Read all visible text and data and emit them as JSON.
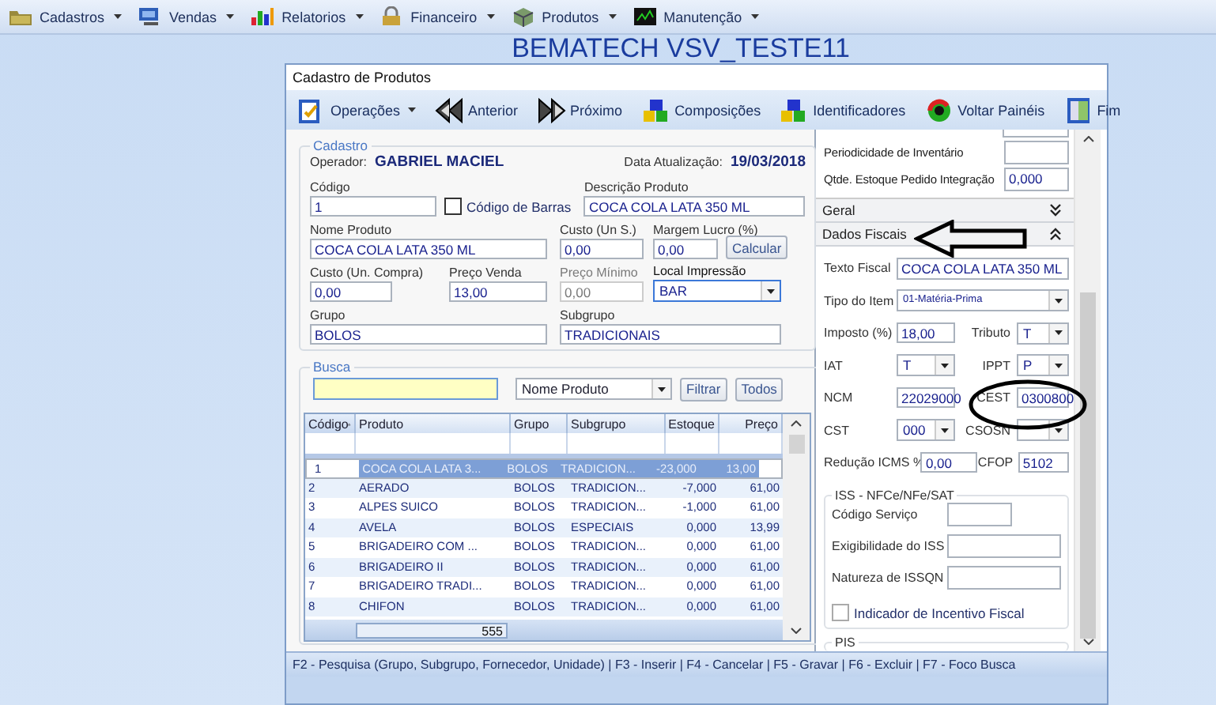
{
  "menu": [
    {
      "label": "Cadastros"
    },
    {
      "label": "Vendas"
    },
    {
      "label": "Relatorios"
    },
    {
      "label": "Financeiro"
    },
    {
      "label": "Produtos"
    },
    {
      "label": "Manutenção"
    }
  ],
  "app_title": "BEMATECH VSV_TESTE11",
  "window": {
    "title": "Cadastro de Produtos"
  },
  "toolbar": [
    {
      "label": "Operações",
      "kind": "dropdown"
    },
    {
      "label": "Anterior",
      "kind": "button"
    },
    {
      "label": "Próximo",
      "kind": "button"
    },
    {
      "label": "Composições",
      "kind": "button"
    },
    {
      "label": "Identificadores",
      "kind": "button"
    },
    {
      "label": "Voltar Painéis",
      "kind": "button"
    },
    {
      "label": "Fim",
      "kind": "button"
    }
  ],
  "cadastro": {
    "legend": "Cadastro",
    "operador_label": "Operador:",
    "operador": "GABRIEL MACIEL",
    "data_label": "Data Atualização:",
    "data": "19/03/2018",
    "codigo": {
      "label": "Código",
      "value": "1"
    },
    "codigo_barras": {
      "label": "Código de Barras",
      "checked": false
    },
    "descricao": {
      "label": "Descrição Produto",
      "value": "COCA COLA LATA 350 ML"
    },
    "nome": {
      "label": "Nome Produto",
      "value": "COCA COLA LATA 350 ML"
    },
    "custo_un_s": {
      "label": "Custo (Un S.)",
      "value": "0,00"
    },
    "margem": {
      "label": "Margem Lucro (%)",
      "value": "0,00"
    },
    "calcular": "Calcular",
    "custo_compra": {
      "label": "Custo (Un. Compra)",
      "value": "0,00"
    },
    "preco_venda": {
      "label": "Preço Venda",
      "value": "13,00"
    },
    "preco_minimo": {
      "label": "Preço Mínimo",
      "value": "0,00",
      "disabled": true
    },
    "local_impressao": {
      "label": "Local Impressão",
      "value": "BAR",
      "focused": true
    },
    "grupo": {
      "label": "Grupo",
      "value": "BOLOS"
    },
    "subgrupo": {
      "label": "Subgrupo",
      "value": "TRADICIONAIS"
    }
  },
  "busca": {
    "legend": "Busca",
    "field_select": "Nome Produto",
    "buttons": [
      "Filtrar",
      "Todos"
    ]
  },
  "grid": {
    "columns": [
      {
        "label": "Código",
        "sorted": true
      },
      {
        "label": "Produto",
        "sorted": false
      },
      {
        "label": "Grupo",
        "sorted": false
      },
      {
        "label": "Subgrupo",
        "sorted": false
      },
      {
        "label": "Estoque",
        "sorted": false
      },
      {
        "label": "Preço",
        "sorted": false
      }
    ],
    "rows": [
      {
        "selected": true,
        "cells": [
          "1",
          "COCA COLA LATA 3...",
          "BOLOS",
          "TRADICION...",
          "-23,000",
          "13,00"
        ]
      },
      {
        "selected": false,
        "cells": [
          "2",
          "AERADO",
          "BOLOS",
          "TRADICION...",
          "-7,000",
          "61,00"
        ]
      },
      {
        "selected": false,
        "cells": [
          "3",
          "ALPES SUICO",
          "BOLOS",
          "TRADICION...",
          "-1,000",
          "61,00"
        ]
      },
      {
        "selected": false,
        "cells": [
          "4",
          "AVELA",
          "BOLOS",
          "ESPECIAIS",
          "0,000",
          "13,99"
        ]
      },
      {
        "selected": false,
        "cells": [
          "5",
          "BRIGADEIRO COM ...",
          "BOLOS",
          "TRADICION...",
          "0,000",
          "61,00"
        ]
      },
      {
        "selected": false,
        "cells": [
          "6",
          "BRIGADEIRO II",
          "BOLOS",
          "TRADICION...",
          "0,000",
          "61,00"
        ]
      },
      {
        "selected": false,
        "cells": [
          "7",
          "BRIGADEIRO TRADI...",
          "BOLOS",
          "TRADICION...",
          "0,000",
          "61,00"
        ]
      },
      {
        "selected": false,
        "cells": [
          "8",
          "CHIFON",
          "BOLOS",
          "TRADICION...",
          "0,000",
          "61,00"
        ]
      }
    ],
    "total": "555"
  },
  "fiscal": {
    "top_fields": [
      {
        "label": "Periodicidade de Inventário"
      },
      {
        "label": "Qtde. Estoque Pedido Integração",
        "value": "0,000"
      }
    ],
    "sections": [
      {
        "label": "Geral",
        "expanded": false
      },
      {
        "label": "Dados Fiscais",
        "expanded": true
      }
    ],
    "rows": [
      [
        {
          "label": "Texto Fiscal",
          "value": "COCA COLA LATA 350 ML",
          "kind": "text"
        }
      ],
      [
        {
          "label": "Tipo do Item",
          "value": "01-Matéria-Prima",
          "kind": "select"
        }
      ],
      [
        {
          "label": "Imposto (%)",
          "value": "18,00",
          "kind": "text"
        },
        {
          "label": "Tributo",
          "value": "T",
          "kind": "select"
        }
      ],
      [
        {
          "label": "IAT",
          "value": "T",
          "kind": "select"
        },
        {
          "label": "IPPT",
          "value": "P",
          "kind": "select"
        }
      ],
      [
        {
          "label": "NCM",
          "value": "22029000",
          "kind": "text"
        },
        {
          "label": "CEST",
          "value": "0300800",
          "kind": "text"
        }
      ],
      [
        {
          "label": "CST",
          "value": "000",
          "kind": "select"
        },
        {
          "label": "CSOSN",
          "kind": "select"
        }
      ],
      [
        {
          "label": "Redução ICMS %",
          "value": "0,00",
          "kind": "text"
        },
        {
          "label": "CFOP",
          "value": "5102",
          "kind": "text"
        }
      ]
    ],
    "iss": {
      "legend": "ISS - NFCe/NFe/SAT",
      "fields": [
        {
          "label": "Código Serviço"
        },
        {
          "label": "Exigibilidade do ISS"
        },
        {
          "label": "Natureza de ISSQN"
        }
      ]
    },
    "incentivo": {
      "label": "Indicador de Incentivo Fiscal",
      "checked": false
    },
    "pis_legend": "PIS"
  },
  "status_bar": "F2 - Pesquisa (Grupo, Subgrupo, Fornecedor, Unidade)  |  F3 - Inserir  |  F4 - Cancelar  |  F5 - Gravar  |  F6 - Excluir  |  F7 - Foco Busca"
}
